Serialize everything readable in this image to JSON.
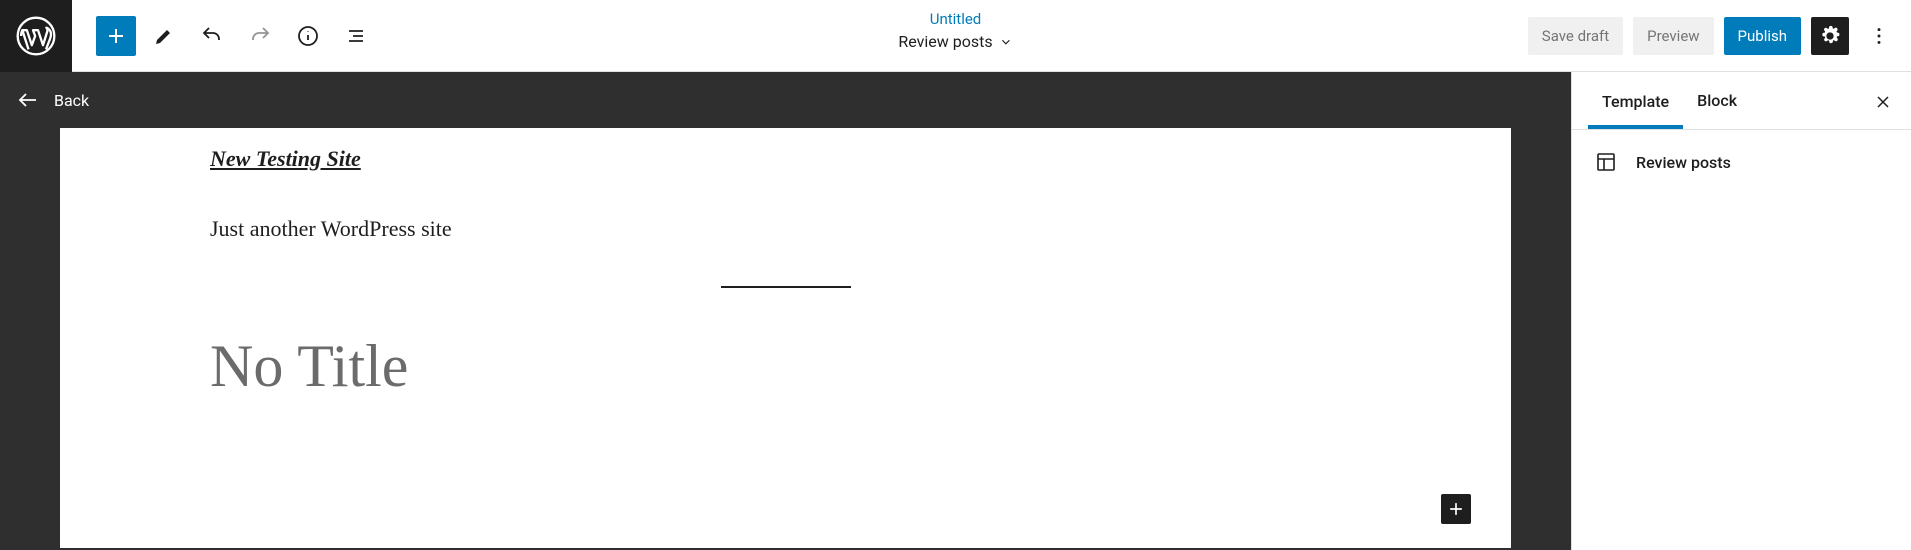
{
  "header": {
    "doc_link": "Untitled",
    "doc_subtitle": "Review posts",
    "save_draft": "Save draft",
    "preview": "Preview",
    "publish": "Publish"
  },
  "back_label": "Back",
  "canvas": {
    "site_title": "New Testing Site",
    "tagline": "Just another WordPress site",
    "post_title_placeholder": "No Title"
  },
  "sidebar": {
    "tabs": {
      "template": "Template",
      "block": "Block"
    },
    "template_name": "Review posts"
  }
}
